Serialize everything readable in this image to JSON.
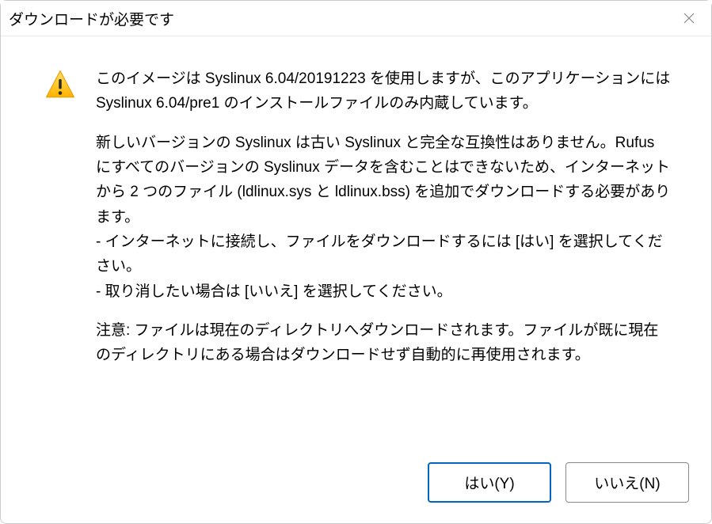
{
  "dialog": {
    "title": "ダウンロードが必要です",
    "icon": "warning-icon",
    "message": {
      "p1": "このイメージは Syslinux 6.04/20191223 を使用しますが、このアプリケーションには Syslinux 6.04/pre1 のインストールファイルのみ内蔵しています。",
      "p2": "新しいバージョンの Syslinux は古い Syslinux と完全な互換性はありません。Rufus にすべてのバージョンの Syslinux データを含むことはできないため、インターネットから 2 つのファイル (ldlinux.sys と ldlinux.bss) を追加でダウンロードする必要があります。\n- インターネットに接続し、ファイルをダウンロードするには [はい] を選択してください。\n- 取り消したい場合は [いいえ] を選択してください。",
      "p3": "注意: ファイルは現在のディレクトリへダウンロードされます。ファイルが既に現在のディレクトリにある場合はダウンロードせず自動的に再使用されます。"
    },
    "buttons": {
      "yes": "はい(Y)",
      "no": "いいえ(N)"
    }
  }
}
